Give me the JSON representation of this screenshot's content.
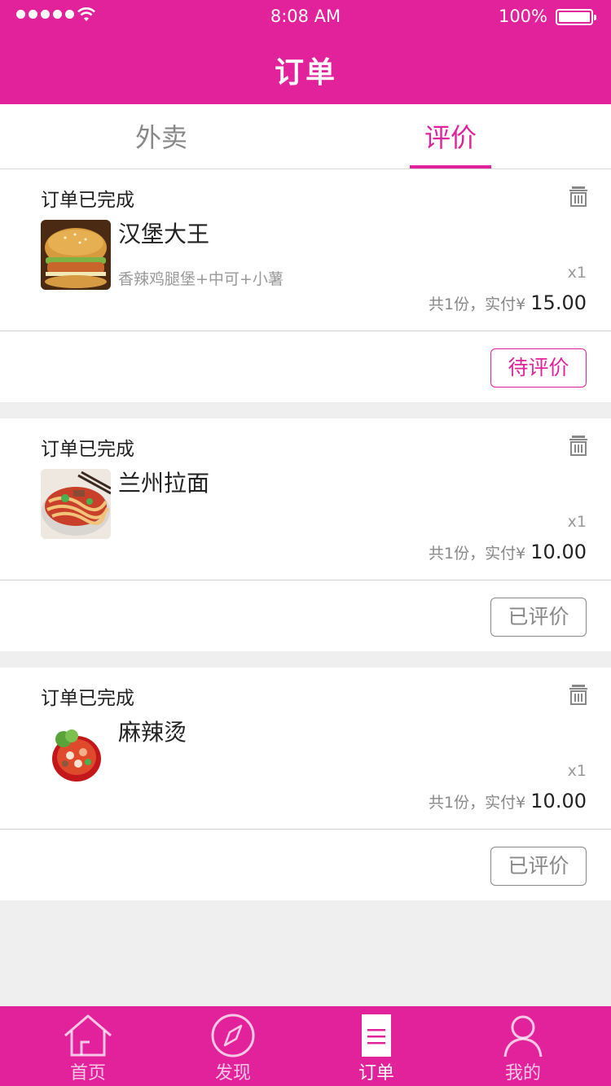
{
  "status_bar": {
    "time": "8:08 AM",
    "battery": "100%"
  },
  "header": {
    "title": "订单"
  },
  "tabs": [
    {
      "label": "外卖",
      "active": false
    },
    {
      "label": "评价",
      "active": true
    }
  ],
  "orders": [
    {
      "status": "订单已完成",
      "shop": "汉堡大王",
      "desc": "香辣鸡腿堡+中可+小薯",
      "qty": "x1",
      "total_prefix": "共1份，实付",
      "currency": "¥",
      "price": "15.00",
      "action": "待评价",
      "image": "burger"
    },
    {
      "status": "订单已完成",
      "shop": "兰州拉面",
      "desc": "",
      "qty": "x1",
      "total_prefix": "共1份，实付",
      "currency": "¥",
      "price": "10.00",
      "action": "已评价",
      "image": "noodles"
    },
    {
      "status": "订单已完成",
      "shop": "麻辣烫",
      "desc": "",
      "qty": "x1",
      "total_prefix": "共1份，实付",
      "currency": "¥",
      "price": "10.00",
      "action": "已评价",
      "image": "malatang"
    }
  ],
  "tabbar": [
    {
      "label": "首页",
      "icon": "home-icon"
    },
    {
      "label": "发现",
      "icon": "compass-icon"
    },
    {
      "label": "订单",
      "icon": "order-icon",
      "active": true
    },
    {
      "label": "我的",
      "icon": "user-icon"
    }
  ],
  "colors": {
    "brand": "#e2229a",
    "background": "#efefef"
  }
}
